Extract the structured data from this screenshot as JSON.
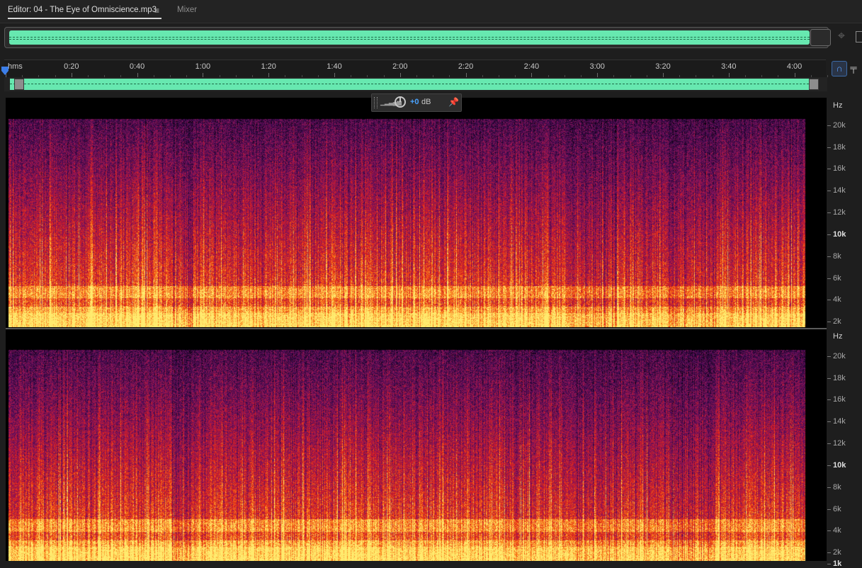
{
  "tabs": {
    "editor_label": "Editor: 04 - The Eye of Omniscience.mp3",
    "menu_glyph": "≡",
    "mixer_label": "Mixer"
  },
  "ruler": {
    "unit": "hms",
    "duration_seconds": 250,
    "labels": [
      "0:20",
      "0:40",
      "1:00",
      "1:20",
      "1:40",
      "2:00",
      "2:20",
      "2:40",
      "3:00",
      "3:20",
      "3:40",
      "4:00"
    ]
  },
  "hud": {
    "value": "+0",
    "unit": "dB"
  },
  "frequency_scale": {
    "unit": "Hz",
    "max_hz": 22050,
    "labels": [
      {
        "text": "20k",
        "hz": 20000,
        "bold": false
      },
      {
        "text": "18k",
        "hz": 18000,
        "bold": false
      },
      {
        "text": "16k",
        "hz": 16000,
        "bold": false
      },
      {
        "text": "14k",
        "hz": 14000,
        "bold": false
      },
      {
        "text": "12k",
        "hz": 12000,
        "bold": false
      },
      {
        "text": "10k",
        "hz": 10000,
        "bold": true
      },
      {
        "text": "8k",
        "hz": 8000,
        "bold": false
      },
      {
        "text": "6k",
        "hz": 6000,
        "bold": false
      },
      {
        "text": "4k",
        "hz": 4000,
        "bold": false
      },
      {
        "text": "2k",
        "hz": 2000,
        "bold": false
      },
      {
        "text": "1k",
        "hz": 1000,
        "bold": true
      }
    ]
  },
  "colors": {
    "waveform": "#67e8b0",
    "accent": "#4aa3ff",
    "spectrogram_high": "#ffe066",
    "spectrogram_mid": "#e0301e",
    "spectrogram_low": "#5a1a6e"
  },
  "icons": {
    "menu": "hamburger-menu-icon",
    "crosshair": "crosshair-icon",
    "snap": "snapping-magnet-icon",
    "marker": "marker-pin-icon",
    "pin": "pin-icon",
    "knob": "volume-knob-icon",
    "meter": "level-meter-icon"
  }
}
